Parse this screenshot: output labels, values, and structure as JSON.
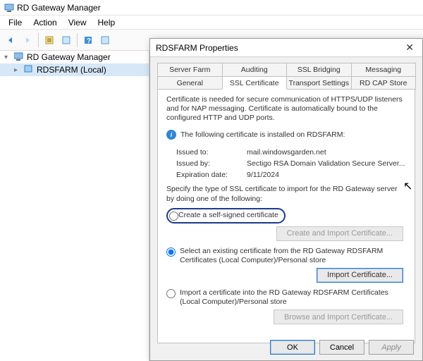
{
  "mgr": {
    "title": "RD Gateway Manager",
    "menu": {
      "file": "File",
      "action": "Action",
      "view": "View",
      "help": "Help"
    },
    "tree": {
      "root": "RD Gateway Manager",
      "node": "RDSFARM (Local)"
    }
  },
  "dlg": {
    "title": "RDSFARM Properties",
    "tabs_top": [
      "Server Farm",
      "Auditing",
      "SSL Bridging",
      "Messaging"
    ],
    "tabs_bottom": [
      "General",
      "SSL Certificate",
      "Transport Settings",
      "RD CAP Store"
    ],
    "desc": "Certificate is needed for secure communication of HTTPS/UDP listeners and for NAP messaging. Certificate is automatically bound to the configured HTTP and UDP ports.",
    "info": "The following certificate is installed on RDSFARM:",
    "issued_to": {
      "k": "Issued to:",
      "v": "mail.windowsgarden.net"
    },
    "issued_by": {
      "k": "Issued by:",
      "v": "Sectigo RSA Domain Validation Secure Server..."
    },
    "expiration": {
      "k": "Expiration date:",
      "v": "9/11/2024"
    },
    "spec": "Specify the type of SSL certificate to import for the RD Gateway server by doing one of the following:",
    "opt1": "Create a self-signed certificate",
    "btn1": "Create and Import Certificate...",
    "opt2": "Select an existing certificate from the RD Gateway RDSFARM Certificates (Local Computer)/Personal store",
    "btn2": "Import Certificate...",
    "opt3": "Import a certificate into the RD Gateway RDSFARM Certificates (Local Computer)/Personal store",
    "btn3": "Browse and Import Certificate...",
    "ok": "OK",
    "cancel": "Cancel",
    "apply": "Apply"
  }
}
